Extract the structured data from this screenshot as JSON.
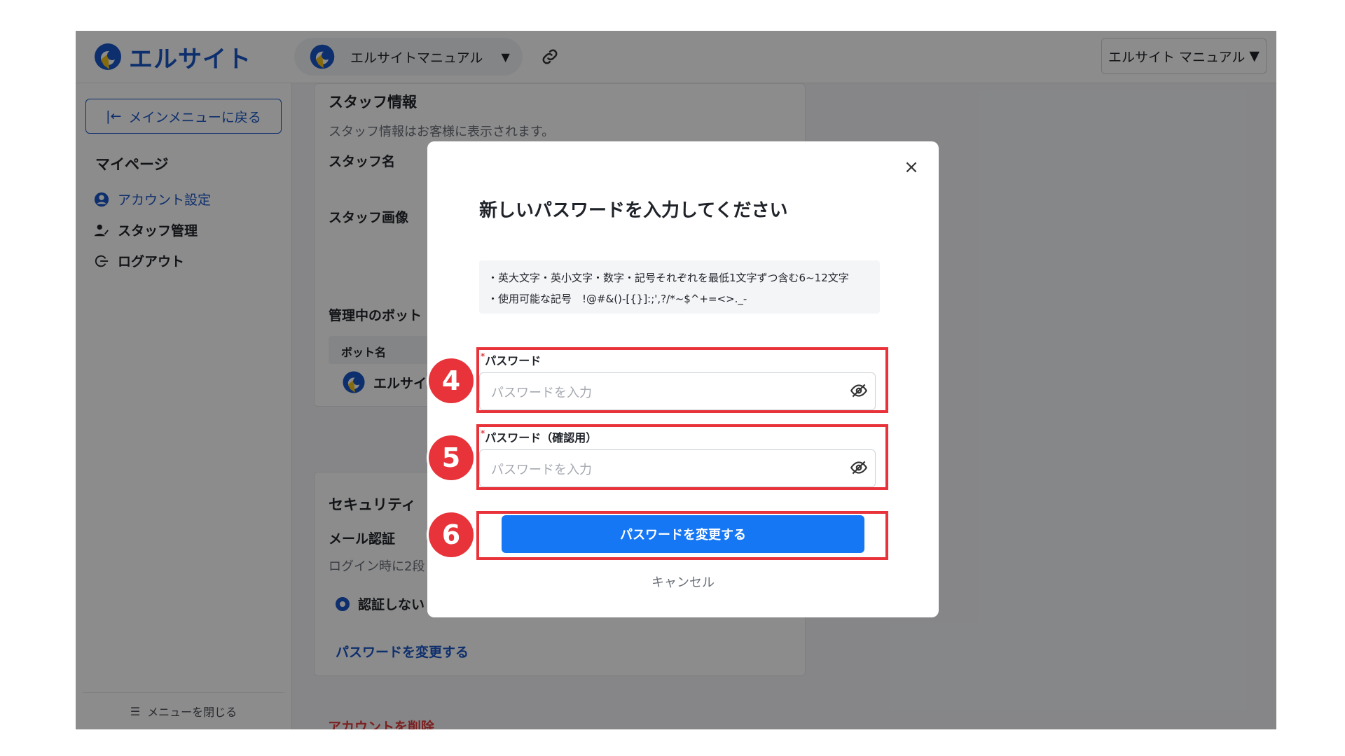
{
  "header": {
    "logo_text": "エルサイト",
    "site_name": "エルサイトマニュアル",
    "site_caret": "▼",
    "user_menu": "エルサイト マニュアル",
    "user_caret": "▼"
  },
  "sidebar": {
    "back_label": "メインメニューに戻る",
    "section_title": "マイページ",
    "items": [
      {
        "label": "アカウント設定",
        "icon": "user-circle-icon",
        "active": true
      },
      {
        "label": "スタッフ管理",
        "icon": "staff-icon",
        "active": false
      },
      {
        "label": "ログアウト",
        "icon": "logout-icon",
        "active": false
      }
    ],
    "footer_label": "メニューを閉じる"
  },
  "main": {
    "staff_title": "スタッフ情報",
    "staff_desc": "スタッフ情報はお客様に表示されます。",
    "staff_name_label": "スタッフ名",
    "staff_image_label": "スタッフ画像",
    "bots_title": "管理中のボット",
    "bots_col": "ボット名",
    "bot_name": "エルサイ",
    "security_title": "セキュリティ",
    "mail_auth_label": "メール認証",
    "mail_auth_desc": "ログイン時に2段",
    "radio_label": "認証しない",
    "change_password_link": "パスワードを変更する",
    "delete_account": "アカウントを削除"
  },
  "modal": {
    "title": "新しいパスワードを入力してください",
    "rule1": "・英大文字・英小文字・数字・記号それぞれを最低1文字ずつ含む6~12文字",
    "rule2": "・使用可能な記号　!@#&()-[{}]:;',?/*~$^+=<>._-",
    "required_mark": "*",
    "password_label": "パスワード",
    "password_placeholder": "パスワードを入力",
    "confirm_label": "パスワード（確認用）",
    "confirm_placeholder": "パスワードを入力",
    "submit_label": "パスワードを変更する",
    "cancel_label": "キャンセル",
    "close_symbol": "×"
  },
  "annotations": {
    "step4": "4",
    "step5": "5",
    "step6": "6",
    "color": "#e8333a"
  },
  "colors": {
    "brand": "#1a56c7",
    "primary_button": "#1677f5",
    "danger": "#e23b3b"
  }
}
